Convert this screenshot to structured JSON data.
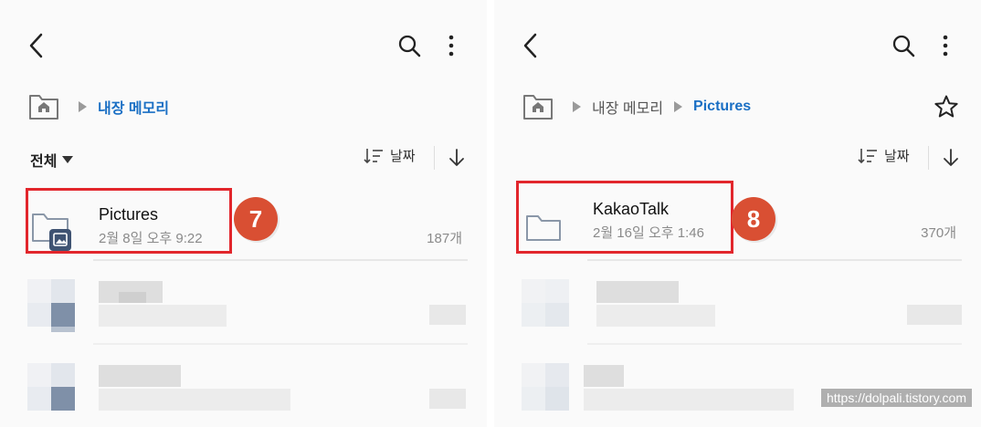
{
  "left_panel": {
    "breadcrumb": [
      "내장 메모리"
    ],
    "filter_label": "전체",
    "sort_label": "날짜",
    "item": {
      "name": "Pictures",
      "date": "2월 8일 오후 9:22",
      "count": "187개"
    },
    "step": "7"
  },
  "right_panel": {
    "breadcrumb": [
      "내장 메모리",
      "Pictures"
    ],
    "sort_label": "날짜",
    "item": {
      "name": "KakaoTalk",
      "date": "2월 16일 오후 1:46",
      "count": "370개"
    },
    "step": "8"
  },
  "watermark": "https://dolpali.tistory.com",
  "colors": {
    "accent": "#1a6fc4",
    "highlight": "#e2262c",
    "badge": "#d94f33"
  },
  "icons": [
    "back-arrow-icon",
    "search-icon",
    "more-vert-icon",
    "home-storage-icon",
    "star-icon",
    "sort-icon",
    "arrow-down-icon",
    "folder-icon",
    "image-badge-icon"
  ]
}
